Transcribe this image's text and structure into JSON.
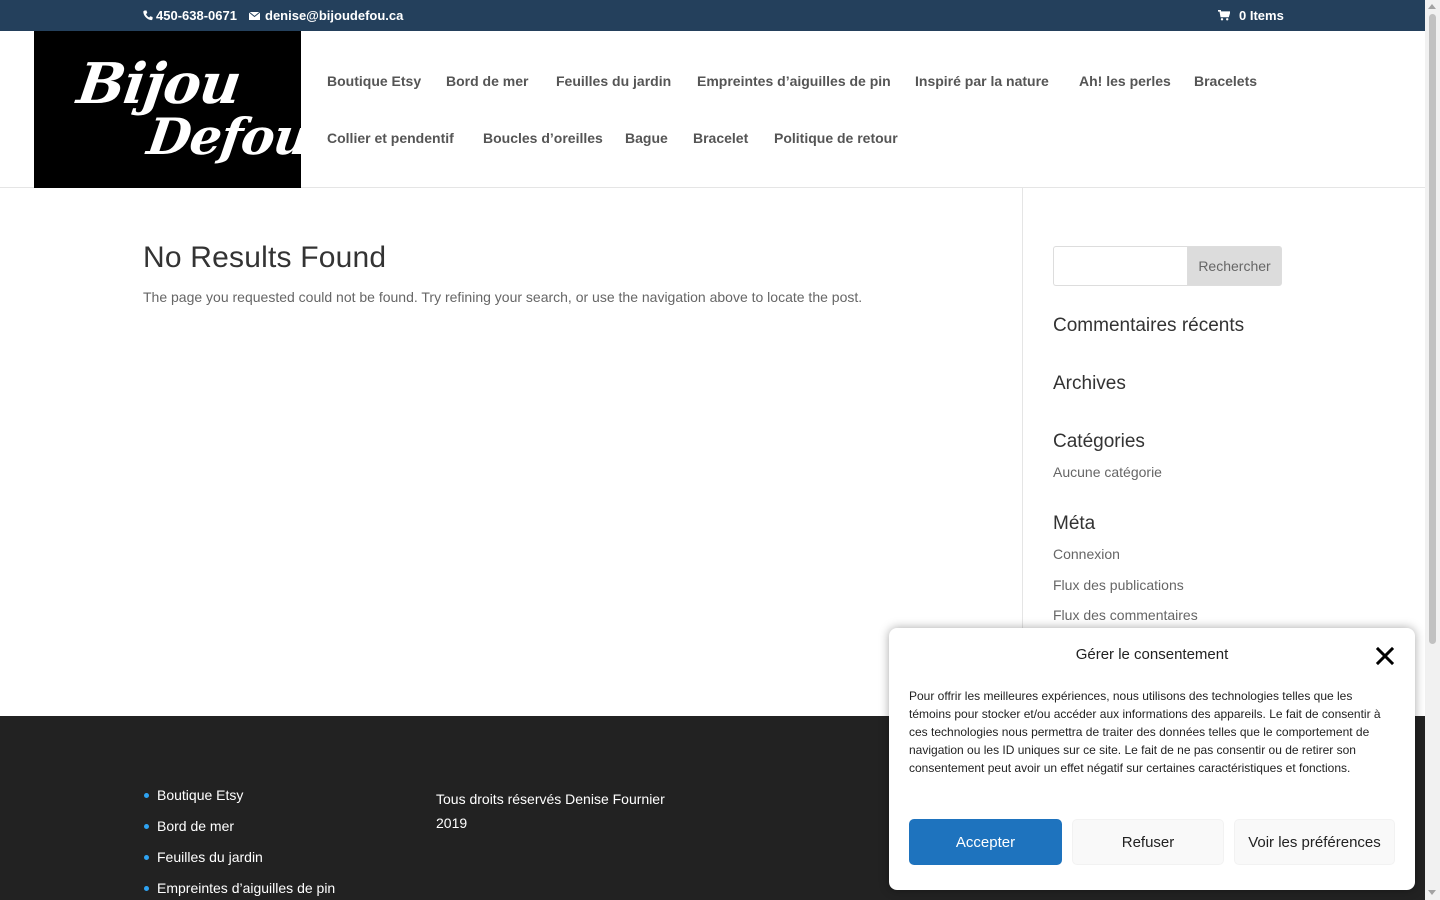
{
  "topbar": {
    "phone": "450-638-0671",
    "email": "denise@bijoudefou.ca",
    "cart": "0 Items"
  },
  "logo": {
    "line1": "Bijou",
    "line2": "Defou"
  },
  "nav": {
    "row1": [
      "Boutique Etsy",
      "Bord de mer",
      "Feuilles du jardin",
      "Empreintes d’aiguilles de pin",
      "Inspiré par la nature",
      "Ah! les perles",
      "Bracelets"
    ],
    "row2": [
      "Collier et pendentif",
      "Boucles d’oreilles",
      "Bague",
      "Bracelet",
      "Politique de retour"
    ]
  },
  "main": {
    "title": "No Results Found",
    "message": "The page you requested could not be found. Try refining your search, or use the navigation above to locate the post."
  },
  "sidebar": {
    "search_button": "Rechercher",
    "search_value": "",
    "recent_comments_title": "Commentaires récents",
    "archives_title": "Archives",
    "categories_title": "Catégories",
    "categories": [
      "Aucune catégorie"
    ],
    "meta_title": "Méta",
    "meta_links": [
      "Connexion",
      "Flux des publications",
      "Flux des commentaires"
    ]
  },
  "footer": {
    "links": [
      "Boutique Etsy",
      "Bord de mer",
      "Feuilles du jardin",
      "Empreintes d’aiguilles de pin"
    ],
    "copyright": "Tous droits réservés Denise Fournier 2019"
  },
  "consent": {
    "title": "Gérer le consentement",
    "body": "Pour offrir les meilleures expériences, nous utilisons des technologies telles que les témoins pour stocker et/ou accéder aux informations des appareils. Le fait de consentir à ces technologies nous permettra de traiter des données telles que le comportement de navigation ou les ID uniques sur ce site. Le fait de ne pas consentir ou de retirer son consentement peut avoir un effet négatif sur certaines caractéristiques et fonctions.",
    "accept": "Accepter",
    "refuse": "Refuser",
    "preferences": "Voir les préférences"
  },
  "colors": {
    "topbar": "#24405c",
    "accent": "#1e73be",
    "footer": "#222222",
    "bullet": "#2ea3f2"
  },
  "icons": {
    "phone": "phone-icon",
    "email": "envelope-icon",
    "cart": "shopping-cart-icon",
    "close": "close-icon"
  }
}
